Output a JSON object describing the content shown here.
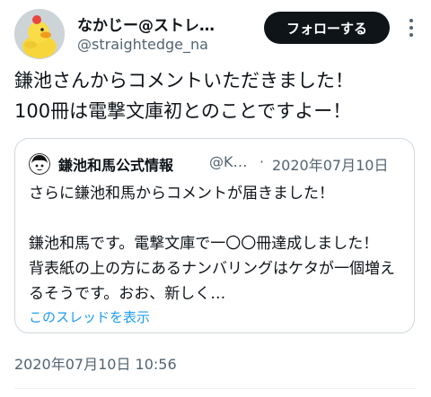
{
  "author": {
    "name": "なかじー@ストレ…",
    "handle": "@straightedge_na",
    "follow_label": "フォローする"
  },
  "tweet": {
    "text": "鎌池さんからコメントいただきました！\n100冊は電撃文庫初とのことですよー！",
    "timestamp": "2020年07月10日 10:56"
  },
  "quoted": {
    "name": "鎌池和馬公式情報",
    "handle": "@K…",
    "separator": "·",
    "date": "2020年07月10日",
    "text": "さらに鎌池和馬からコメントが届きました！\n\n鎌池和馬です。電撃文庫で一〇〇冊達成しました！　背表紙の上の方にあるナンバリングはケタが一個増えるそうです。おお、新しく…",
    "thread_link": "このスレッドを表示"
  },
  "icons": {
    "more": "more-horizontal-icon",
    "avatar": "duck-avatar",
    "quoted_avatar": "character-avatar"
  },
  "colors": {
    "link": "#1d9bf0",
    "secondary_text": "#536471",
    "follow_bg": "#0f1419",
    "border": "#cfd9de"
  }
}
